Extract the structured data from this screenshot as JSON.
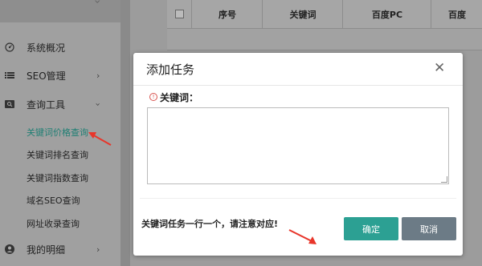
{
  "sidebar": {
    "items": [
      {
        "label": "系统概况",
        "icon": "dashboard-icon"
      },
      {
        "label": "SEO管理",
        "icon": "list-icon"
      },
      {
        "label": "查询工具",
        "icon": "search-icon"
      },
      {
        "label": "我的明细",
        "icon": "user-icon"
      }
    ],
    "submenu": [
      {
        "label": "关键词价格查询",
        "active": true
      },
      {
        "label": "关键词排名查询"
      },
      {
        "label": "关键词指数查询"
      },
      {
        "label": "域名SEO查询"
      },
      {
        "label": "网址收录查询"
      }
    ]
  },
  "table": {
    "headers": [
      "序号",
      "关键词",
      "百度PC",
      "百度"
    ]
  },
  "modal": {
    "title": "添加任务",
    "field_label": "关键词：",
    "textarea_value": "",
    "note": "关键词任务一行一个，请注意对应!",
    "ok_label": "确定",
    "cancel_label": "取消"
  },
  "colors": {
    "accent": "#2ca093",
    "cancel": "#6c7b86",
    "annotation_arrow": "#e8352a"
  }
}
